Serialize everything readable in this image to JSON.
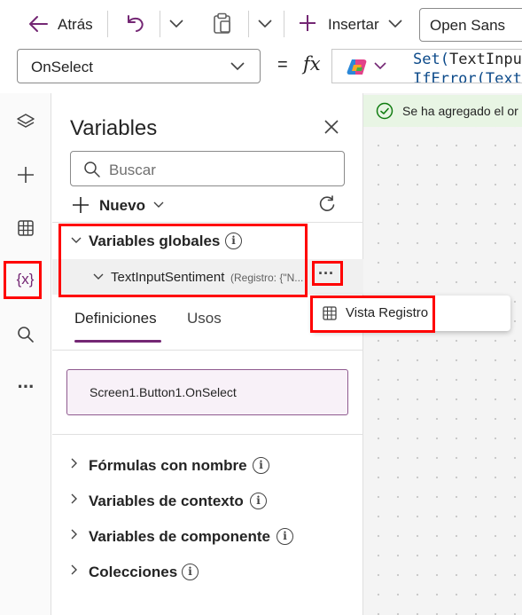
{
  "toolbar": {
    "back_label": "Atrás",
    "insert_label": "Insertar",
    "font_value": "Open Sans",
    "property_value": "OnSelect",
    "equals": "=",
    "fx": "fx",
    "formula_line1_fn": "Set(",
    "formula_line1_rest": "TextInpu",
    "formula_line2": "IfError(Text"
  },
  "rail": {
    "items": [
      "layers-icon",
      "plus-icon",
      "data-grid-icon",
      "variables-icon",
      "search-icon",
      "more-icon"
    ],
    "variables_label": "{x}",
    "more_label": "···",
    "accent_color": "#742774"
  },
  "panel": {
    "title": "Variables",
    "search_placeholder": "Buscar",
    "new_label": "Nuevo",
    "global_vars_label": "Variables globales",
    "variable_name": "TextInputSentiment",
    "variable_meta": "(Registro: {\"N...",
    "more_button": "···",
    "tabs": [
      "Definiciones",
      "Usos"
    ],
    "active_tab": "Definiciones",
    "definition": "Screen1.Button1.OnSelect",
    "sections": [
      "Fórmulas con nombre",
      "Variables de contexto",
      "Variables de componente",
      "Colecciones"
    ]
  },
  "context_menu": {
    "item_label": "Vista Registro"
  },
  "notification": {
    "text": "Se ha agregado el or"
  },
  "colors": {
    "highlight": "#ff0000",
    "accent": "#742774",
    "success": "#107c10",
    "formula_blue": "#0c4a8a"
  }
}
